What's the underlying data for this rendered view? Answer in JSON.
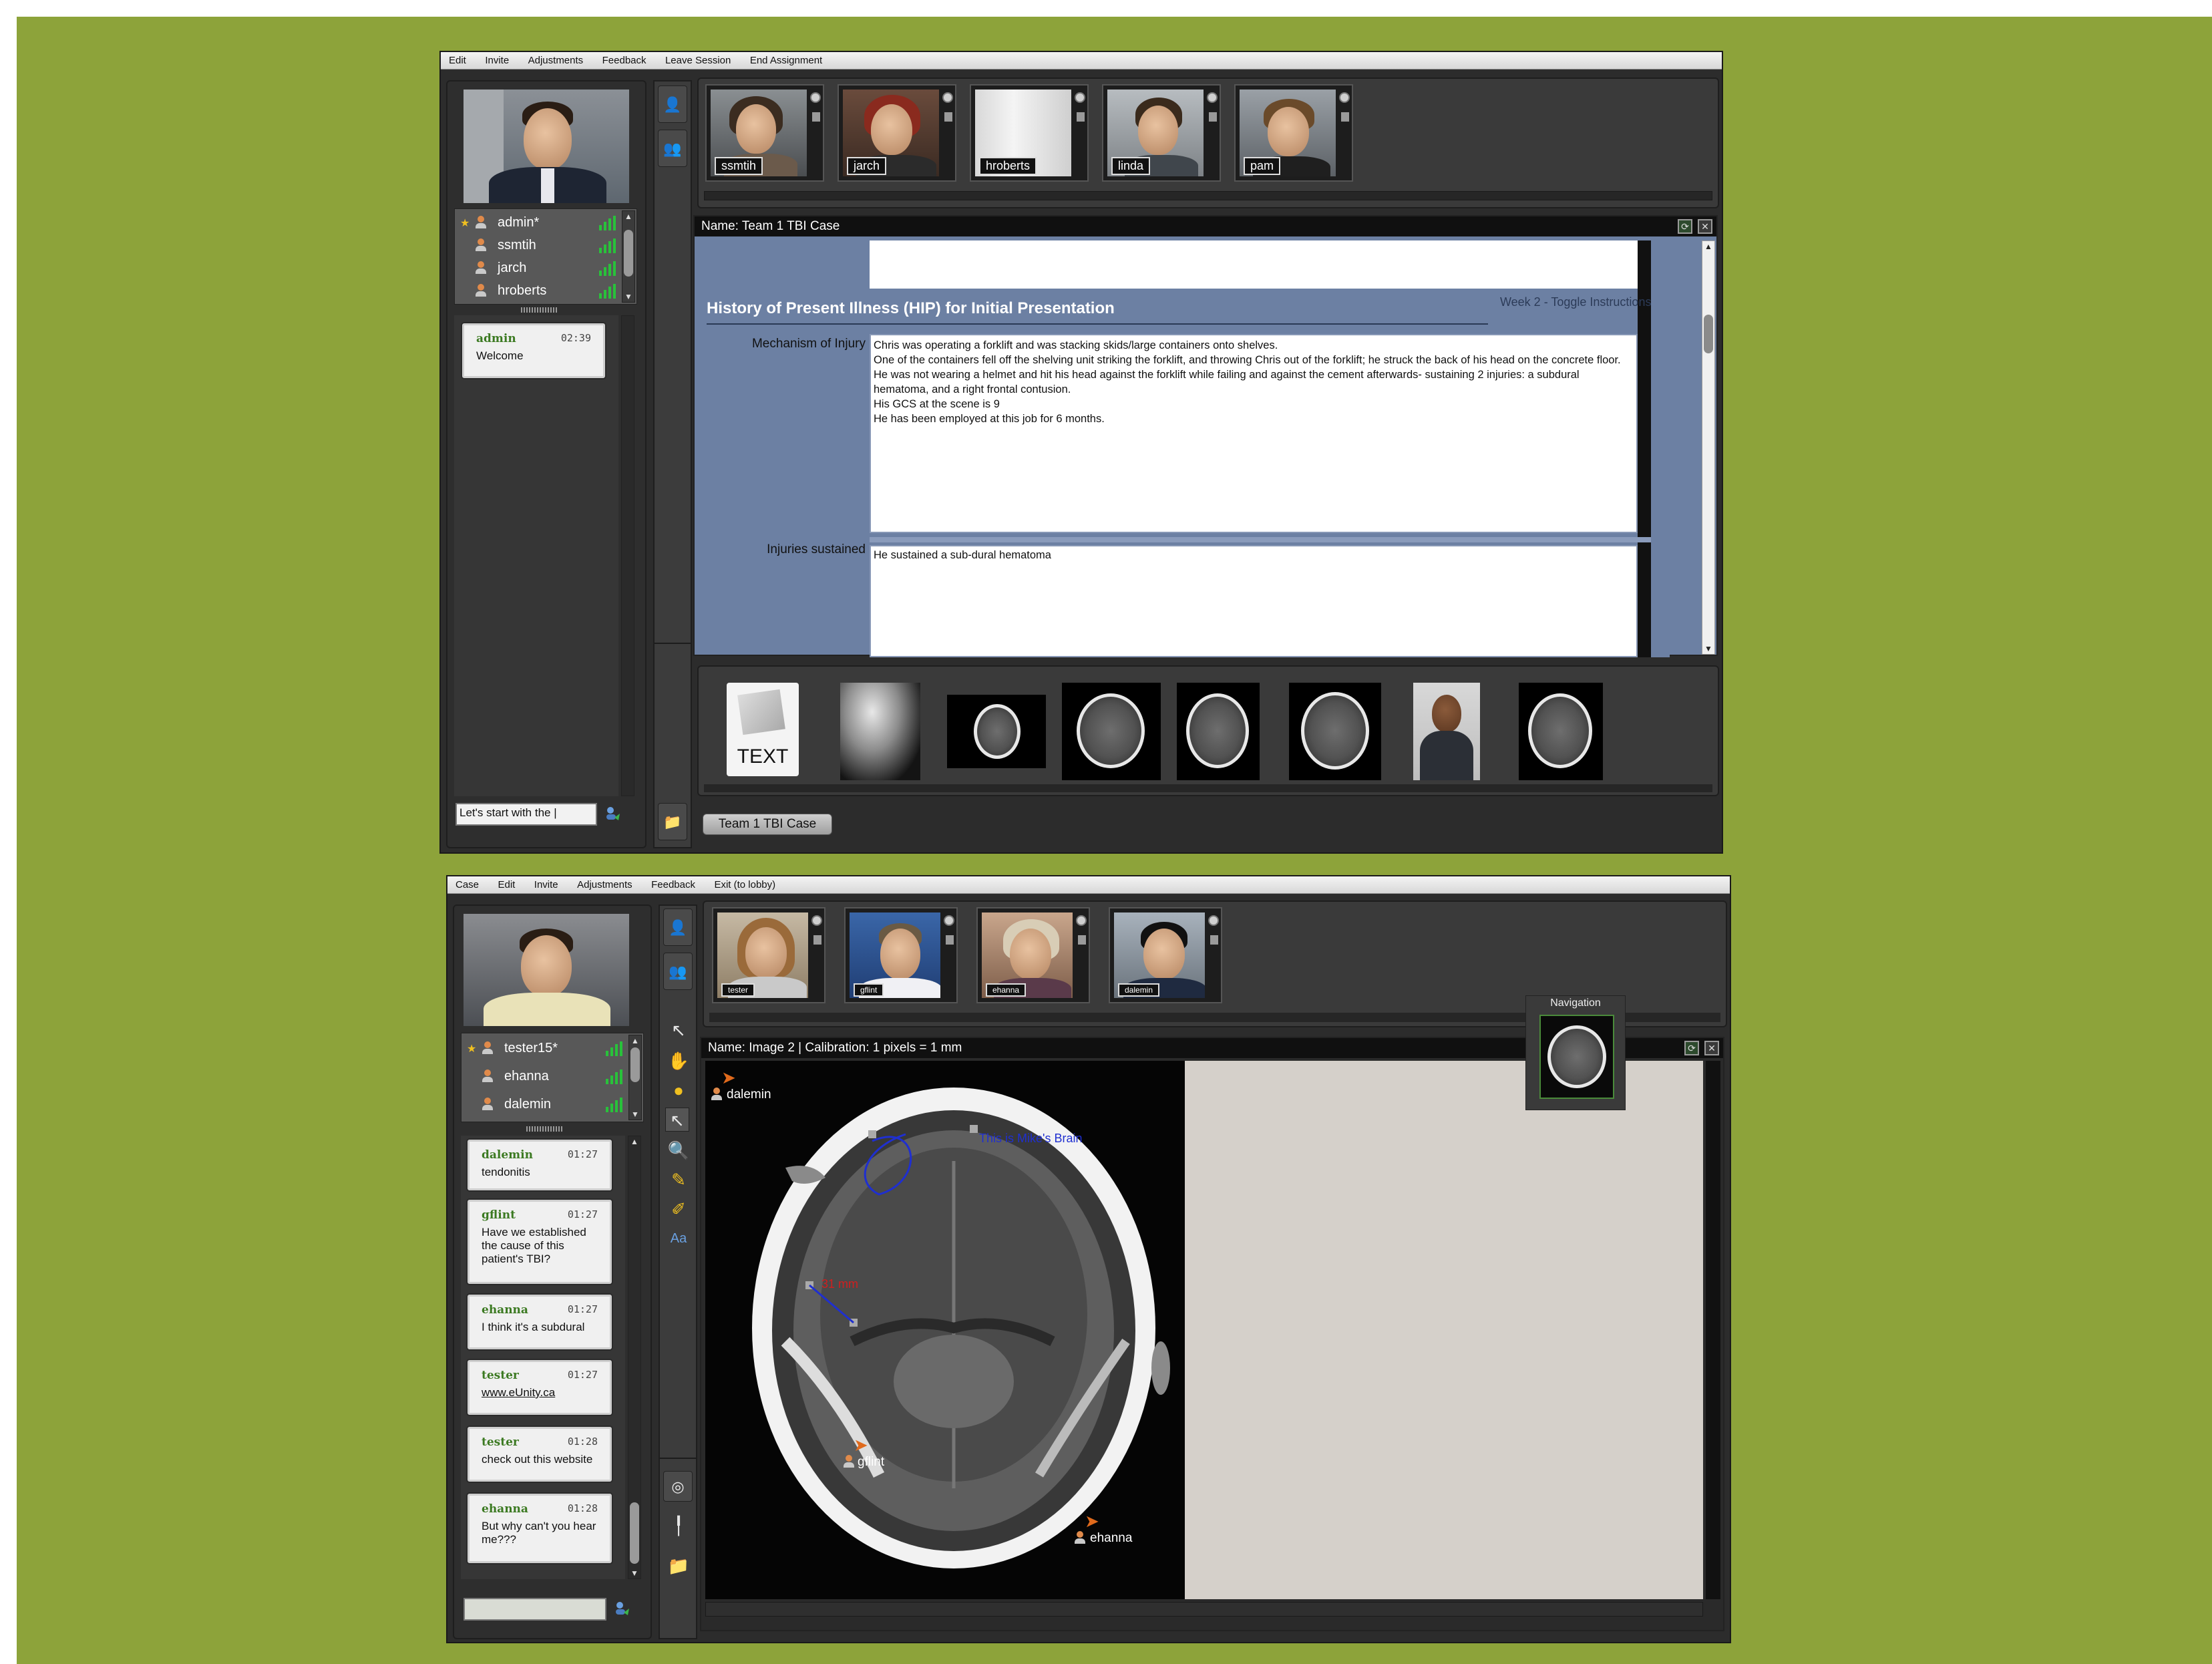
{
  "top_app": {
    "menu": [
      "Edit",
      "Invite",
      "Adjustments",
      "Feedback",
      "Leave Session",
      "End Assignment"
    ],
    "users": [
      {
        "name": "admin*",
        "starred": true
      },
      {
        "name": "ssmtih",
        "starred": false
      },
      {
        "name": "jarch",
        "starred": false
      },
      {
        "name": "hroberts",
        "starred": false
      }
    ],
    "chat": [
      {
        "user": "admin",
        "time": "02:39",
        "text": "Welcome"
      }
    ],
    "chat_input_value": "Let's start with the |",
    "participants": [
      "ssmtih",
      "jarch",
      "hroberts",
      "linda",
      "pam"
    ],
    "document": {
      "window_title": "Name: Team 1 TBI Case",
      "section_title": "History of Present Illness (HIP) for Initial Presentation",
      "toggle_link": "Week 2 - Toggle Instructions",
      "fields": [
        {
          "label": "Mechanism of Injury",
          "lines": [
            "Chris was operating a forklift and was stacking skids/large containers onto shelves.",
            "One of the containers fell off the shelving unit striking the forklift, and throwing Chris out of the forklift; he struck the back of his head on the concrete floor.",
            "He was not wearing a helmet and hit his head against the forklift while failing and against the cement afterwards- sustaining 2 injuries: a subdural hematoma, and a right frontal contusion.",
            "His GCS at the scene is 9",
            "He has been employed at this job for 6 months."
          ]
        },
        {
          "label": "Injuries sustained",
          "lines": [
            "He sustained a sub-dural hematoma"
          ]
        }
      ]
    },
    "gallery": [
      {
        "kind": "text-file",
        "label": "TEXT"
      },
      {
        "kind": "xray"
      },
      {
        "kind": "ct"
      },
      {
        "kind": "ct"
      },
      {
        "kind": "ct"
      },
      {
        "kind": "ct"
      },
      {
        "kind": "photo"
      },
      {
        "kind": "ct"
      }
    ],
    "case_tab": "Team 1 TBI Case"
  },
  "bottom_app": {
    "menu": [
      "Case",
      "Edit",
      "Invite",
      "Adjustments",
      "Feedback",
      "Exit (to lobby)"
    ],
    "users": [
      {
        "name": "tester15*",
        "starred": true
      },
      {
        "name": "ehanna",
        "starred": false
      },
      {
        "name": "dalemin",
        "starred": false
      }
    ],
    "chat": [
      {
        "user": "dalemin",
        "time": "01:27",
        "text": "tendonitis"
      },
      {
        "user": "gflint",
        "time": "01:27",
        "text": "Have we established the cause of this patient's TBI?"
      },
      {
        "user": "ehanna",
        "time": "01:27",
        "text": "I think it's a subdural"
      },
      {
        "user": "tester",
        "time": "01:27",
        "text": "www.eUnity.ca"
      },
      {
        "user": "tester",
        "time": "01:28",
        "text": "check out this website"
      },
      {
        "user": "ehanna",
        "time": "01:28",
        "text": "But why can't you hear me???"
      }
    ],
    "chat_input_value": "",
    "participants": [
      "tester",
      "gflint",
      "ehanna",
      "dalemin"
    ],
    "navigation_label": "Navigation",
    "image_window_title": "Name: Image 2 | Calibration: 1 pixels = 1 mm",
    "cursors": [
      "dalemin",
      "gflint",
      "ehanna"
    ],
    "annotations": [
      {
        "text": "This is Mike's Brain",
        "color": "#1f2fd0"
      },
      {
        "text": "31 mm",
        "color": "#d01f1f"
      }
    ]
  },
  "colors": {
    "backdrop": "#8da33a",
    "doc_blue": "#6c80a3",
    "signal_green": "#28c23a",
    "chat_user": "#3c7a22"
  },
  "icons": [
    "user-add-icon",
    "user-settings-icon",
    "pointer-icon",
    "hand-icon",
    "circle-icon",
    "select-icon",
    "zoom-icon",
    "pen-icon",
    "highlighter-icon",
    "text-tool-icon",
    "folder-icon",
    "send-icon"
  ]
}
